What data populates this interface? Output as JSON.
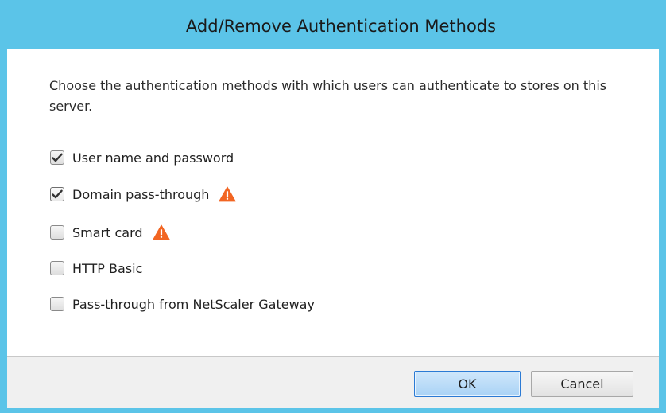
{
  "dialog": {
    "title": "Add/Remove Authentication Methods",
    "instructions": "Choose the authentication methods with which users can authenticate to stores on this server."
  },
  "options": [
    {
      "label": "User name and password",
      "checked": true,
      "warning": false,
      "focused": true
    },
    {
      "label": "Domain pass-through",
      "checked": true,
      "warning": true,
      "focused": false
    },
    {
      "label": "Smart card",
      "checked": false,
      "warning": true,
      "focused": false
    },
    {
      "label": "HTTP Basic",
      "checked": false,
      "warning": false,
      "focused": false
    },
    {
      "label": "Pass-through from NetScaler Gateway",
      "checked": false,
      "warning": false,
      "focused": false
    }
  ],
  "buttons": {
    "ok_label": "OK",
    "cancel_label": "Cancel"
  },
  "icons": {
    "checkmark": "checkmark-icon",
    "warning": "warning-icon"
  },
  "colors": {
    "title_bar": "#5bc4e8",
    "warning": "#f26522",
    "ok_border": "#2b7ad4"
  }
}
